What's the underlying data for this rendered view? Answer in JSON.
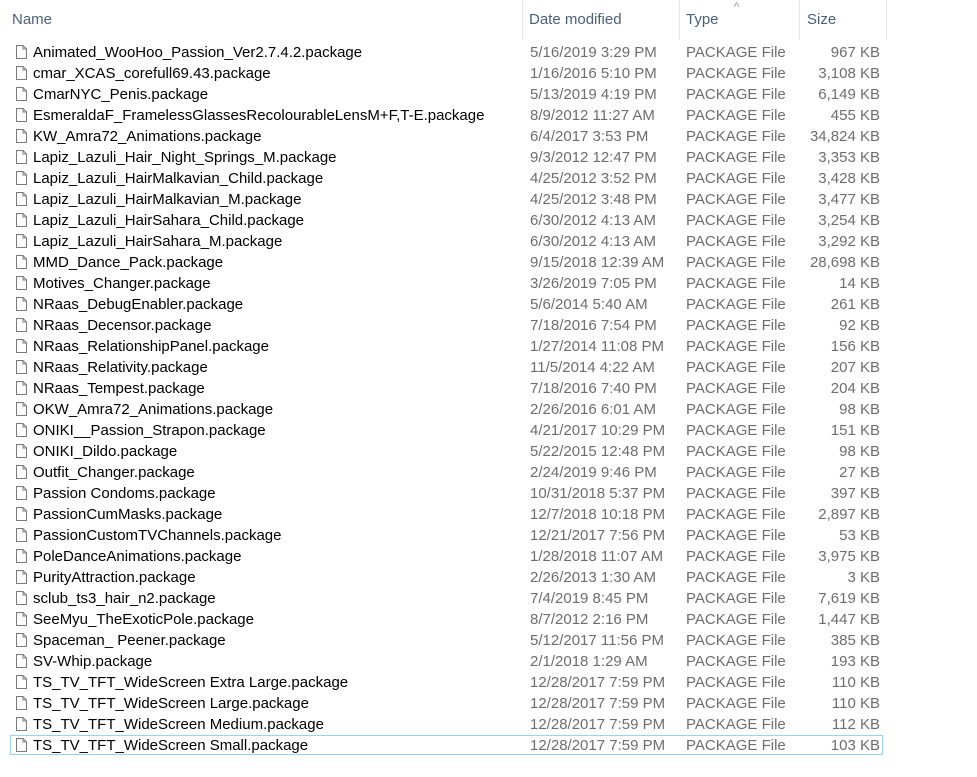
{
  "columns": {
    "name": "Name",
    "date": "Date modified",
    "type": "Type",
    "size": "Size"
  },
  "sort_indicator": "^",
  "files": [
    {
      "name": "Animated_WooHoo_Passion_Ver2.7.4.2.package",
      "date": "5/16/2019 3:29 PM",
      "type": "PACKAGE File",
      "size": "967 KB"
    },
    {
      "name": "cmar_XCAS_corefull69.43.package",
      "date": "1/16/2016 5:10 PM",
      "type": "PACKAGE File",
      "size": "3,108 KB"
    },
    {
      "name": "CmarNYC_Penis.package",
      "date": "5/13/2019 4:19 PM",
      "type": "PACKAGE File",
      "size": "6,149 KB"
    },
    {
      "name": "EsmeraldaF_FramelessGlassesRecolourableLensM+F,T-E.package",
      "date": "8/9/2012 11:27 AM",
      "type": "PACKAGE File",
      "size": "455 KB"
    },
    {
      "name": "KW_Amra72_Animations.package",
      "date": "6/4/2017 3:53 PM",
      "type": "PACKAGE File",
      "size": "34,824 KB"
    },
    {
      "name": "Lapiz_Lazuli_Hair_Night_Springs_M.package",
      "date": "9/3/2012 12:47 PM",
      "type": "PACKAGE File",
      "size": "3,353 KB"
    },
    {
      "name": "Lapiz_Lazuli_HairMalkavian_Child.package",
      "date": "4/25/2012 3:52 PM",
      "type": "PACKAGE File",
      "size": "3,428 KB"
    },
    {
      "name": "Lapiz_Lazuli_HairMalkavian_M.package",
      "date": "4/25/2012 3:48 PM",
      "type": "PACKAGE File",
      "size": "3,477 KB"
    },
    {
      "name": "Lapiz_Lazuli_HairSahara_Child.package",
      "date": "6/30/2012 4:13 AM",
      "type": "PACKAGE File",
      "size": "3,254 KB"
    },
    {
      "name": "Lapiz_Lazuli_HairSahara_M.package",
      "date": "6/30/2012 4:13 AM",
      "type": "PACKAGE File",
      "size": "3,292 KB"
    },
    {
      "name": "MMD_Dance_Pack.package",
      "date": "9/15/2018 12:39 AM",
      "type": "PACKAGE File",
      "size": "28,698 KB"
    },
    {
      "name": "Motives_Changer.package",
      "date": "3/26/2019 7:05 PM",
      "type": "PACKAGE File",
      "size": "14 KB"
    },
    {
      "name": "NRaas_DebugEnabler.package",
      "date": "5/6/2014 5:40 AM",
      "type": "PACKAGE File",
      "size": "261 KB"
    },
    {
      "name": "NRaas_Decensor.package",
      "date": "7/18/2016 7:54 PM",
      "type": "PACKAGE File",
      "size": "92 KB"
    },
    {
      "name": "NRaas_RelationshipPanel.package",
      "date": "1/27/2014 11:08 PM",
      "type": "PACKAGE File",
      "size": "156 KB"
    },
    {
      "name": "NRaas_Relativity.package",
      "date": "11/5/2014 4:22 AM",
      "type": "PACKAGE File",
      "size": "207 KB"
    },
    {
      "name": "NRaas_Tempest.package",
      "date": "7/18/2016 7:40 PM",
      "type": "PACKAGE File",
      "size": "204 KB"
    },
    {
      "name": "OKW_Amra72_Animations.package",
      "date": "2/26/2016 6:01 AM",
      "type": "PACKAGE File",
      "size": "98 KB"
    },
    {
      "name": "ONIKI__Passion_Strapon.package",
      "date": "4/21/2017 10:29 PM",
      "type": "PACKAGE File",
      "size": "151 KB"
    },
    {
      "name": "ONIKI_Dildo.package",
      "date": "5/22/2015 12:48 PM",
      "type": "PACKAGE File",
      "size": "98 KB"
    },
    {
      "name": "Outfit_Changer.package",
      "date": "2/24/2019 9:46 PM",
      "type": "PACKAGE File",
      "size": "27 KB"
    },
    {
      "name": "Passion Condoms.package",
      "date": "10/31/2018 5:37 PM",
      "type": "PACKAGE File",
      "size": "397 KB"
    },
    {
      "name": "PassionCumMasks.package",
      "date": "12/7/2018 10:18 PM",
      "type": "PACKAGE File",
      "size": "2,897 KB"
    },
    {
      "name": "PassionCustomTVChannels.package",
      "date": "12/21/2017 7:56 PM",
      "type": "PACKAGE File",
      "size": "53 KB"
    },
    {
      "name": "PoleDanceAnimations.package",
      "date": "1/28/2018 11:07 AM",
      "type": "PACKAGE File",
      "size": "3,975 KB"
    },
    {
      "name": "PurityAttraction.package",
      "date": "2/26/2013 1:30 AM",
      "type": "PACKAGE File",
      "size": "3 KB"
    },
    {
      "name": "sclub_ts3_hair_n2.package",
      "date": "7/4/2019 8:45 PM",
      "type": "PACKAGE File",
      "size": "7,619 KB"
    },
    {
      "name": "SeeMyu_TheExoticPole.package",
      "date": "8/7/2012 2:16 PM",
      "type": "PACKAGE File",
      "size": "1,447 KB"
    },
    {
      "name": "Spaceman_ Peener.package",
      "date": "5/12/2017 11:56 PM",
      "type": "PACKAGE File",
      "size": "385 KB"
    },
    {
      "name": "SV-Whip.package",
      "date": "2/1/2018 1:29 AM",
      "type": "PACKAGE File",
      "size": "193 KB"
    },
    {
      "name": "TS_TV_TFT_WideScreen Extra Large.package",
      "date": "12/28/2017 7:59 PM",
      "type": "PACKAGE File",
      "size": "110 KB"
    },
    {
      "name": "TS_TV_TFT_WideScreen Large.package",
      "date": "12/28/2017 7:59 PM",
      "type": "PACKAGE File",
      "size": "110 KB"
    },
    {
      "name": "TS_TV_TFT_WideScreen Medium.package",
      "date": "12/28/2017 7:59 PM",
      "type": "PACKAGE File",
      "size": "112 KB"
    },
    {
      "name": "TS_TV_TFT_WideScreen Small.package",
      "date": "12/28/2017 7:59 PM",
      "type": "PACKAGE File",
      "size": "103 KB",
      "selected": true
    }
  ],
  "icon": "document-icon"
}
